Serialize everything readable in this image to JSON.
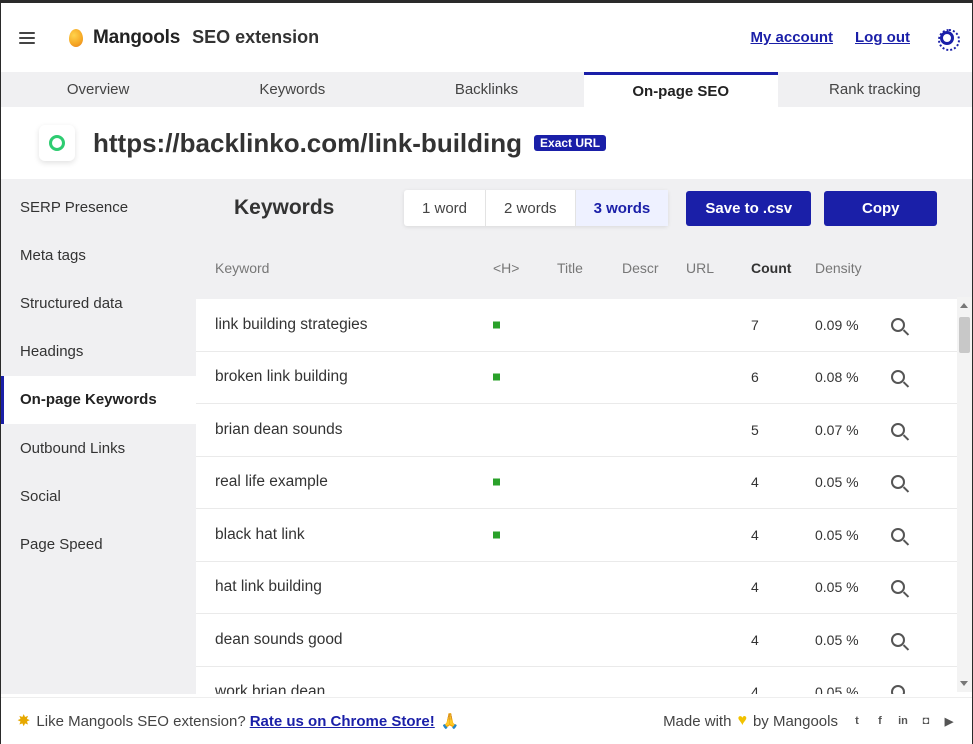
{
  "header": {
    "brand": "Mangools",
    "product": "SEO extension",
    "my_account": "My account",
    "log_out": "Log out"
  },
  "tabs": [
    {
      "label": "Overview"
    },
    {
      "label": "Keywords"
    },
    {
      "label": "Backlinks"
    },
    {
      "label": "On-page SEO"
    },
    {
      "label": "Rank tracking"
    }
  ],
  "url_bar": {
    "url": "https://backlinko.com/link-building",
    "badge": "Exact URL"
  },
  "sidebar": [
    {
      "label": "SERP Presence"
    },
    {
      "label": "Meta tags"
    },
    {
      "label": "Structured data"
    },
    {
      "label": "Headings"
    },
    {
      "label": "On-page Keywords"
    },
    {
      "label": "Outbound Links"
    },
    {
      "label": "Social"
    },
    {
      "label": "Page Speed"
    }
  ],
  "main": {
    "title": "Keywords",
    "segments": [
      "1 word",
      "2 words",
      "3 words"
    ],
    "save_csv": "Save to .csv",
    "copy": "Copy"
  },
  "columns": {
    "keyword": "Keyword",
    "h": "<H>",
    "title": "Title",
    "descr": "Descr",
    "url": "URL",
    "count": "Count",
    "density": "Density"
  },
  "rows": [
    {
      "keyword": "link building strategies",
      "count": "7",
      "density": "0.09 %"
    },
    {
      "keyword": "broken link building",
      "count": "6",
      "density": "0.08 %"
    },
    {
      "keyword": "brian dean sounds",
      "count": "5",
      "density": "0.07 %"
    },
    {
      "keyword": "real life example",
      "count": "4",
      "density": "0.05 %"
    },
    {
      "keyword": "black hat link",
      "count": "4",
      "density": "0.05 %"
    },
    {
      "keyword": "hat link building",
      "count": "4",
      "density": "0.05 %"
    },
    {
      "keyword": "dean sounds good",
      "count": "4",
      "density": "0.05 %"
    },
    {
      "keyword": "work brian dean",
      "count": "4",
      "density": "0.05 %"
    }
  ],
  "footer": {
    "like_text": "Like Mangools SEO extension?",
    "rate_link": "Rate us on Chrome Store!",
    "made_with": "Made with",
    "by": "by Mangools"
  }
}
